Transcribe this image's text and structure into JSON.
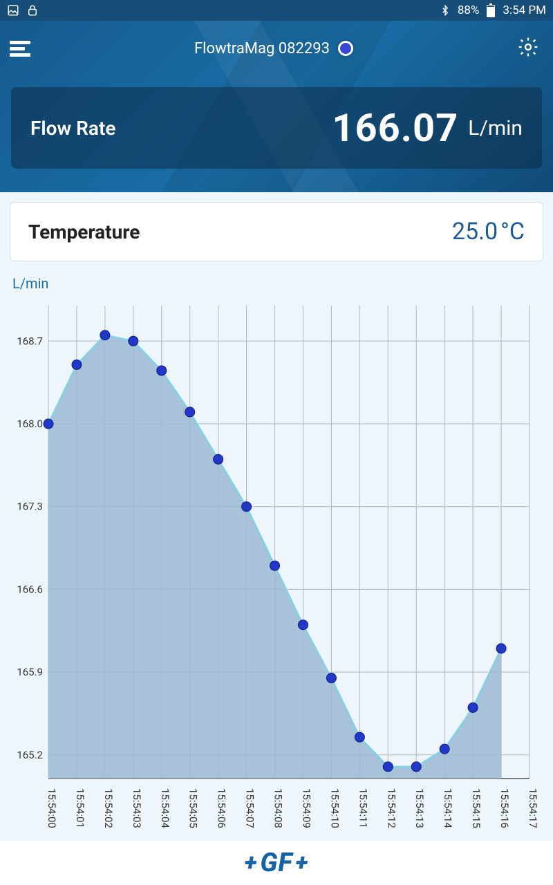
{
  "status": {
    "battery_pct": "88%",
    "time": "3:54 PM"
  },
  "header": {
    "title": "FlowtraMag 082293"
  },
  "flow": {
    "label": "Flow Rate",
    "value": "166.07",
    "unit": "L/min"
  },
  "temperature": {
    "label": "Temperature",
    "value": "25.0",
    "unit": "°C"
  },
  "chart": {
    "axis_title": "L/min"
  },
  "footer": {
    "brand": "GF"
  },
  "chart_data": {
    "type": "area",
    "title": "",
    "xlabel": "",
    "ylabel": "L/min",
    "ylim": [
      165.0,
      169.0
    ],
    "x": [
      "15:54:00",
      "15:54:01",
      "15:54:02",
      "15:54:03",
      "15:54:04",
      "15:54:05",
      "15:54:06",
      "15:54:07",
      "15:54:08",
      "15:54:09",
      "15:54:10",
      "15:54:11",
      "15:54:12",
      "15:54:13",
      "15:54:14",
      "15:54:15",
      "15:54:16"
    ],
    "xticks": [
      "15:54:00",
      "15:54:01",
      "15:54:02",
      "15:54:03",
      "15:54:04",
      "15:54:05",
      "15:54:06",
      "15:54:07",
      "15:54:08",
      "15:54:09",
      "15:54:10",
      "15:54:11",
      "15:54:12",
      "15:54:13",
      "15:54:14",
      "15:54:15",
      "15:54:16",
      "15:54:17"
    ],
    "yticks": [
      165.2,
      165.9,
      166.6,
      167.3,
      168.0,
      168.7
    ],
    "values": [
      168.0,
      168.5,
      168.75,
      168.7,
      168.45,
      168.1,
      167.7,
      167.3,
      166.8,
      166.3,
      165.85,
      165.35,
      165.1,
      165.1,
      165.25,
      165.6,
      166.1
    ]
  }
}
